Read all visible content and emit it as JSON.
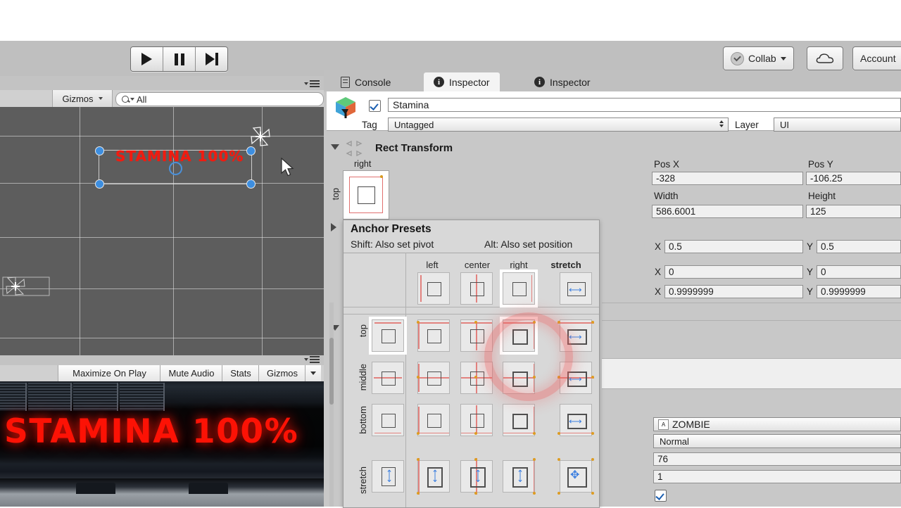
{
  "toolbar": {
    "play_icon": "play-icon",
    "pause_icon": "pause-icon",
    "step_icon": "step-icon",
    "collab_label": "Collab",
    "cloud_icon": "cloud-icon",
    "account_label": "Account"
  },
  "scene_view": {
    "gizmos_label": "Gizmos",
    "search_value": "All",
    "search_icon": "search-icon",
    "menu_icon": "panel-menu-icon",
    "overlay_text": "STAMINA 100%",
    "selection": {
      "handle_icon": "resize-handle",
      "pivot_icon": "pivot-circle",
      "rotate_icon": "rotate-gizmo-icon"
    },
    "cursor_icon": "mouse-pointer-icon"
  },
  "game_view": {
    "maximize_label": "Maximize On Play",
    "mute_label": "Mute Audio",
    "stats_label": "Stats",
    "gizmos_label": "Gizmos",
    "menu_icon": "panel-menu-icon",
    "hud_text": "STAMINA 100%",
    "hud_color": "#fc1205"
  },
  "inspector": {
    "tabs": [
      {
        "label": "Console",
        "icon": "console-icon",
        "active": false
      },
      {
        "label": "Inspector",
        "icon": "info-icon",
        "active": true
      },
      {
        "label": "Inspector",
        "icon": "info-icon",
        "active": false
      }
    ],
    "object": {
      "icon": "prefab-cube-icon",
      "enabled_checkbox": "enabled-checkbox",
      "name": "Stamina",
      "tag_label": "Tag",
      "tag_value": "Untagged",
      "layer_label": "Layer",
      "layer_value": "UI"
    },
    "rect_transform": {
      "title": "Rect Transform",
      "anchor_preview": {
        "col_label": "right",
        "row_label": "top"
      },
      "fields": [
        {
          "label": "Pos X",
          "value": "-328"
        },
        {
          "label": "Pos Y",
          "value": "-106.25"
        },
        {
          "label": "Width",
          "value": "586.6001"
        },
        {
          "label": "Height",
          "value": "125"
        }
      ],
      "pivot": {
        "x_label": "X",
        "x_value": "0.5",
        "y_label": "Y",
        "y_value": "0.5"
      },
      "anchor_min": {
        "x_label": "X",
        "x_value": "0",
        "y_label": "Y",
        "y_value": "0"
      },
      "anchor_max": {
        "x_label": "X",
        "x_value": "0.9999999",
        "y_label": "Y",
        "y_value": "0.9999999"
      }
    },
    "text_component": {
      "font_icon": "font-asset-icon",
      "font_value": "ZOMBIE",
      "font_style_value": "Normal",
      "font_size_value": "76",
      "line_spacing_value": "1",
      "rich_text_checkbox": "rich-text-checkbox"
    }
  },
  "anchor_presets": {
    "title": "Anchor Presets",
    "hint_shift": "Shift: Also set pivot",
    "hint_alt": "Alt: Also set position",
    "columns": [
      "left",
      "center",
      "right",
      "stretch"
    ],
    "rows": [
      "top",
      "middle",
      "bottom",
      "stretch"
    ],
    "selected_column": "right",
    "selected_row": "top",
    "highlight_color": "#ec6060"
  },
  "colors": {
    "chrome": "#bfbfbf",
    "panel": "#c8c8c8",
    "scene_bg": "#5d5d5d",
    "accent_blue": "#3d8ee0",
    "anchor_red": "#e2827f",
    "anchor_dot": "#dd9c22"
  }
}
